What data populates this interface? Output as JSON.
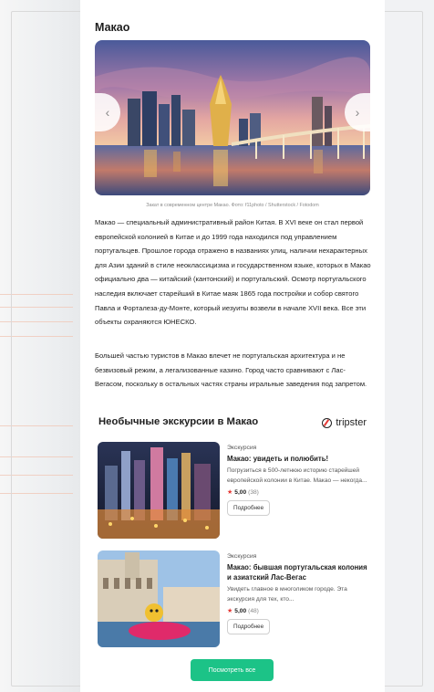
{
  "article": {
    "title": "Макао",
    "hero_caption": "Закат в современном центре Макао. Фото: f11photo / Shutterstock / Fotodom",
    "paragraph_1": "Макао — специальный административный район Китая. В XVI веке он стал первой европейской колонией в Китае и до 1999 года находился под управлением португальцев. Прошлое города отражено в названиях улиц, наличии нехарактерных для Азии зданий в стиле неоклассицизма и государственном языке, которых в Макао официально два — китайский (кантонский) и португальский. Осмотр португальского наследия включает старейший в Китае маяк 1865 года постройки и собор святого Павла и Форталеза-ду-Монте, который иезуиты возвели в начале XVII века. Все эти объекты охраняются ЮНЕСКО.",
    "paragraph_2": "Большей частью туристов в Макао влечет не португальская архитектура и не безвизовый режим, а легализованные казино. Город часто сравнивают с Лас-Вегасом, поскольку в остальных частях страны игральные заведения под запретом."
  },
  "slider": {
    "prev_label": "‹",
    "next_label": "›"
  },
  "excursions": {
    "heading": "Необычные экскурсии в Макао",
    "brand": "tripster",
    "items": [
      {
        "type": "Экскурсия",
        "name": "Макао: увидеть и полюбить!",
        "description": "Погрузиться в 500-летнюю историю старейшей европейской колонии в Китае. Макао — некогда...",
        "rating": "5,00",
        "reviews": "(38)",
        "button": "Подробнее"
      },
      {
        "type": "Экскурсия",
        "name": "Макао: бывшая португальская колония и азиатский Лас-Вегас",
        "description": "Увидеть главное в многоликом городе. Эта экскурсия для тех, кто...",
        "rating": "5,00",
        "reviews": "(48)",
        "button": "Подробнее"
      }
    ],
    "see_all": "Посмотреть все"
  },
  "colors": {
    "accent": "#1cc387",
    "star": "#e53935"
  }
}
